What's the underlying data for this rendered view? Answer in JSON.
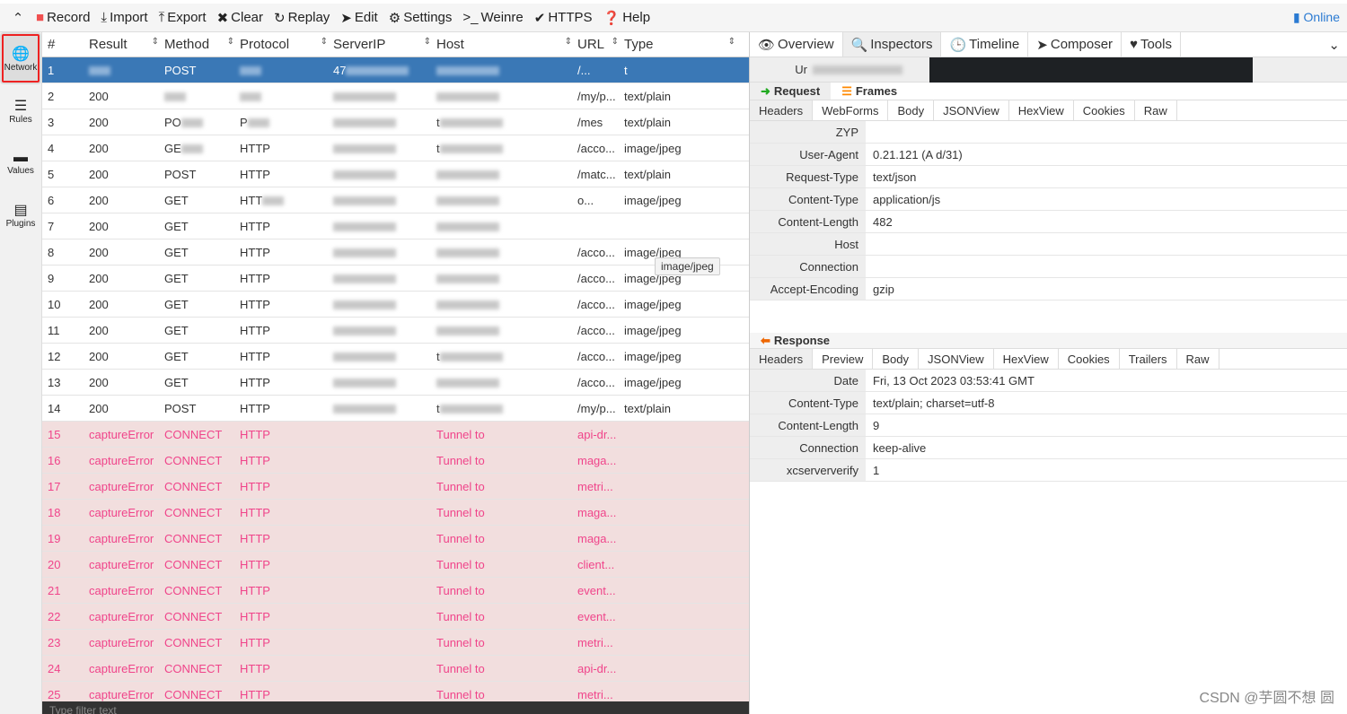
{
  "toolbar": {
    "items": [
      {
        "icon": "square-icon",
        "glyph": "■",
        "label": "Record",
        "color": "#f05050"
      },
      {
        "icon": "import-icon",
        "glyph": "⤓",
        "label": "Import"
      },
      {
        "icon": "export-icon",
        "glyph": "⤒",
        "label": "Export"
      },
      {
        "icon": "close-icon",
        "glyph": "✖",
        "label": "Clear"
      },
      {
        "icon": "replay-icon",
        "glyph": "↻",
        "label": "Replay"
      },
      {
        "icon": "send-icon",
        "glyph": "➤",
        "label": "Edit"
      },
      {
        "icon": "gear-icon",
        "glyph": "⚙",
        "label": "Settings"
      },
      {
        "icon": "terminal-icon",
        "glyph": ">_",
        "label": "Weinre"
      },
      {
        "icon": "check-icon",
        "glyph": "✔",
        "label": "HTTPS"
      },
      {
        "icon": "help-icon",
        "glyph": "❓",
        "label": "Help"
      }
    ],
    "online": "Online"
  },
  "sidebar": [
    {
      "label": "Network",
      "glyph": "🌐"
    },
    {
      "label": "Rules",
      "glyph": "☰"
    },
    {
      "label": "Values",
      "glyph": "▬"
    },
    {
      "label": "Plugins",
      "glyph": "▤"
    }
  ],
  "columns": [
    "#",
    "Result",
    "Method",
    "Protocol",
    "ServerIP",
    "Host",
    "URL",
    "Type"
  ],
  "rows": [
    {
      "n": "1",
      "result": "",
      "method": "POST",
      "protocol": "",
      "ip": "47",
      "host": "",
      "url": "/...",
      "type": "t",
      "state": "selected"
    },
    {
      "n": "2",
      "result": "200",
      "method": "",
      "protocol": "",
      "ip": "",
      "host": "",
      "url": "/my/p...",
      "type": "text/plain"
    },
    {
      "n": "3",
      "result": "200",
      "method": "PO",
      "protocol": "P",
      "ip": "",
      "host": "t",
      "url": "/mes",
      "type": "text/plain"
    },
    {
      "n": "4",
      "result": "200",
      "method": "GE",
      "protocol": "HTTP",
      "ip": "",
      "host": "t",
      "url": "/acco...",
      "type": "image/jpeg"
    },
    {
      "n": "5",
      "result": "200",
      "method": "POST",
      "protocol": "HTTP",
      "ip": "",
      "host": "",
      "url": "/matc...",
      "type": "text/plain"
    },
    {
      "n": "6",
      "result": "200",
      "method": "GET",
      "protocol": "HTT",
      "ip": "",
      "host": "",
      "url": "o...",
      "type": "image/jpeg"
    },
    {
      "n": "7",
      "result": "200",
      "method": "GET",
      "protocol": "HTTP",
      "ip": "",
      "host": "",
      "url": "",
      "type": ""
    },
    {
      "n": "8",
      "result": "200",
      "method": "GET",
      "protocol": "HTTP",
      "ip": "",
      "host": "",
      "url": "/acco...",
      "type": "image/jpeg"
    },
    {
      "n": "9",
      "result": "200",
      "method": "GET",
      "protocol": "HTTP",
      "ip": "",
      "host": "",
      "url": "/acco...",
      "type": "image/jpeg"
    },
    {
      "n": "10",
      "result": "200",
      "method": "GET",
      "protocol": "HTTP",
      "ip": "",
      "host": "",
      "url": "/acco...",
      "type": "image/jpeg"
    },
    {
      "n": "11",
      "result": "200",
      "method": "GET",
      "protocol": "HTTP",
      "ip": "",
      "host": "",
      "url": "/acco...",
      "type": "image/jpeg"
    },
    {
      "n": "12",
      "result": "200",
      "method": "GET",
      "protocol": "HTTP",
      "ip": "",
      "host": "t",
      "url": "/acco...",
      "type": "image/jpeg"
    },
    {
      "n": "13",
      "result": "200",
      "method": "GET",
      "protocol": "HTTP",
      "ip": "",
      "host": "",
      "url": "/acco...",
      "type": "image/jpeg"
    },
    {
      "n": "14",
      "result": "200",
      "method": "POST",
      "protocol": "HTTP",
      "ip": "",
      "host": "t",
      "url": "/my/p...",
      "type": "text/plain"
    },
    {
      "n": "15",
      "result": "captureError",
      "method": "CONNECT",
      "protocol": "HTTP",
      "ip": "",
      "host": "Tunnel to",
      "url": "api-dr...",
      "type": "",
      "state": "error"
    },
    {
      "n": "16",
      "result": "captureError",
      "method": "CONNECT",
      "protocol": "HTTP",
      "ip": "",
      "host": "Tunnel to",
      "url": "maga...",
      "type": "",
      "state": "error"
    },
    {
      "n": "17",
      "result": "captureError",
      "method": "CONNECT",
      "protocol": "HTTP",
      "ip": "",
      "host": "Tunnel to",
      "url": "metri...",
      "type": "",
      "state": "error"
    },
    {
      "n": "18",
      "result": "captureError",
      "method": "CONNECT",
      "protocol": "HTTP",
      "ip": "",
      "host": "Tunnel to",
      "url": "maga...",
      "type": "",
      "state": "error"
    },
    {
      "n": "19",
      "result": "captureError",
      "method": "CONNECT",
      "protocol": "HTTP",
      "ip": "",
      "host": "Tunnel to",
      "url": "maga...",
      "type": "",
      "state": "error"
    },
    {
      "n": "20",
      "result": "captureError",
      "method": "CONNECT",
      "protocol": "HTTP",
      "ip": "",
      "host": "Tunnel to",
      "url": "client...",
      "type": "",
      "state": "error"
    },
    {
      "n": "21",
      "result": "captureError",
      "method": "CONNECT",
      "protocol": "HTTP",
      "ip": "",
      "host": "Tunnel to",
      "url": "event...",
      "type": "",
      "state": "error"
    },
    {
      "n": "22",
      "result": "captureError",
      "method": "CONNECT",
      "protocol": "HTTP",
      "ip": "",
      "host": "Tunnel to",
      "url": "event...",
      "type": "",
      "state": "error"
    },
    {
      "n": "23",
      "result": "captureError",
      "method": "CONNECT",
      "protocol": "HTTP",
      "ip": "",
      "host": "Tunnel to",
      "url": "metri...",
      "type": "",
      "state": "error"
    },
    {
      "n": "24",
      "result": "captureError",
      "method": "CONNECT",
      "protocol": "HTTP",
      "ip": "",
      "host": "Tunnel to",
      "url": "api-dr...",
      "type": "",
      "state": "error"
    },
    {
      "n": "25",
      "result": "captureError",
      "method": "CONNECT",
      "protocol": "HTTP",
      "ip": "",
      "host": "Tunnel to",
      "url": "metri...",
      "type": "",
      "state": "error"
    }
  ],
  "tooltip": "image/jpeg",
  "filter_placeholder": "Type filter text",
  "right": {
    "tabs": [
      {
        "glyph": "👁",
        "label": "Overview"
      },
      {
        "glyph": "🔍",
        "label": "Inspectors",
        "active": true
      },
      {
        "glyph": "🕒",
        "label": "Timeline"
      },
      {
        "glyph": "➤",
        "label": "Composer"
      },
      {
        "glyph": "♥",
        "label": "Tools"
      }
    ],
    "url_label": "Ur",
    "request_label": "Request",
    "frames_label": "Frames",
    "req_tabs": [
      "Headers",
      "WebForms",
      "Body",
      "JSONView",
      "HexView",
      "Cookies",
      "Raw"
    ],
    "req_headers": [
      {
        "k": "ZYP",
        "v": ""
      },
      {
        "k": "User-Agent",
        "v": "0.21.121 (A d/31)"
      },
      {
        "k": "Request-Type",
        "v": "text/json"
      },
      {
        "k": "Content-Type",
        "v": "application/js"
      },
      {
        "k": "Content-Length",
        "v": "482"
      },
      {
        "k": "Host",
        "v": ""
      },
      {
        "k": "Connection",
        "v": ""
      },
      {
        "k": "Accept-Encoding",
        "v": "gzip"
      }
    ],
    "response_label": "Response",
    "res_tabs": [
      "Headers",
      "Preview",
      "Body",
      "JSONView",
      "HexView",
      "Cookies",
      "Trailers",
      "Raw"
    ],
    "res_headers": [
      {
        "k": "Date",
        "v": "Fri, 13 Oct 2023 03:53:41 GMT"
      },
      {
        "k": "Content-Type",
        "v": "text/plain; charset=utf-8"
      },
      {
        "k": "Content-Length",
        "v": "9"
      },
      {
        "k": "Connection",
        "v": "keep-alive"
      },
      {
        "k": "xcserververify",
        "v": "1"
      }
    ]
  },
  "watermark": "CSDN @芋圆不想 圆"
}
